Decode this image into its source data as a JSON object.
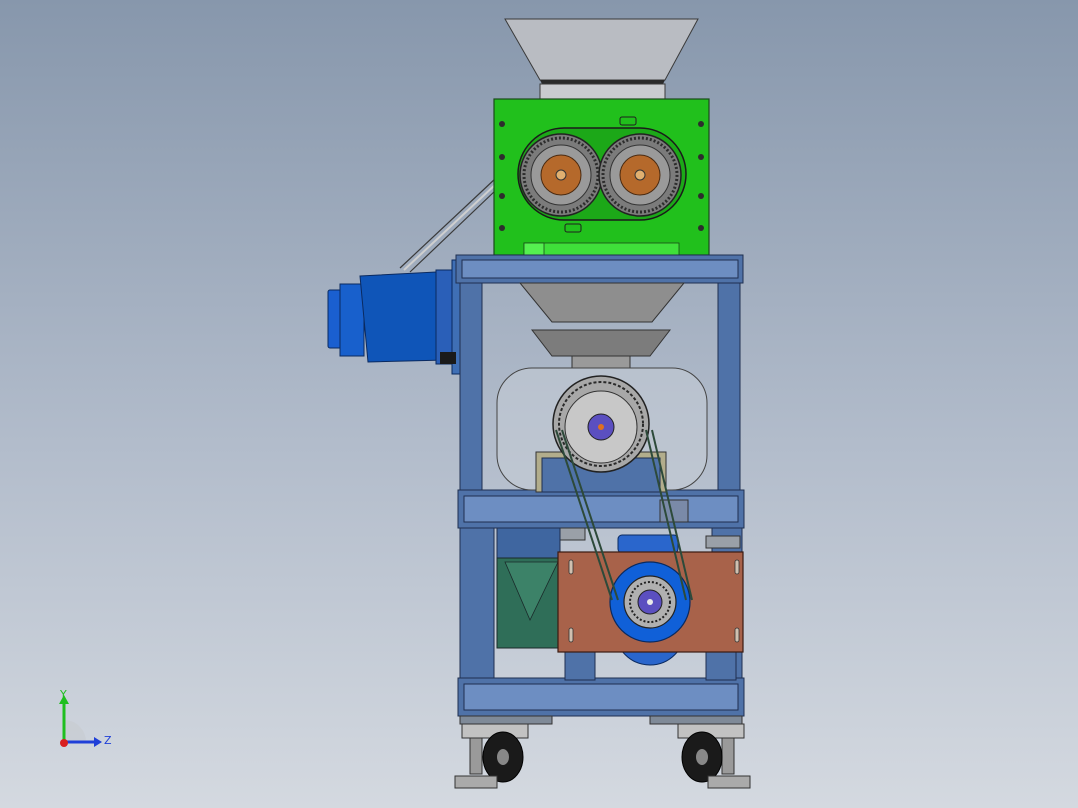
{
  "viewport": {
    "background_top": "#8797ac",
    "background_bottom": "#d4d9e0"
  },
  "model": {
    "components": [
      {
        "name": "feed-hopper",
        "color": "#c8c8c8"
      },
      {
        "name": "roller-housing",
        "color": "#22c21e"
      },
      {
        "name": "roller-left",
        "color": "#b5692b"
      },
      {
        "name": "roller-right",
        "color": "#b5692b"
      },
      {
        "name": "gear-motor",
        "color": "#0f55b8"
      },
      {
        "name": "frame",
        "color": "#4f72a8"
      },
      {
        "name": "lower-hopper",
        "color": "#8e8e8e"
      },
      {
        "name": "pulley-upper",
        "color": "#5b4fc0"
      },
      {
        "name": "motor-mount-plate",
        "color": "#a8624a"
      },
      {
        "name": "pulley-lower",
        "color": "#1060d8"
      },
      {
        "name": "chute",
        "color": "#2f6e58"
      },
      {
        "name": "casters",
        "color": "#1a1a1a"
      }
    ]
  },
  "triad": {
    "y_label": "Y",
    "z_label": "Z",
    "y_color": "#1fbf1f",
    "z_color": "#1f3fd8",
    "x_color": "#d81f1f"
  }
}
